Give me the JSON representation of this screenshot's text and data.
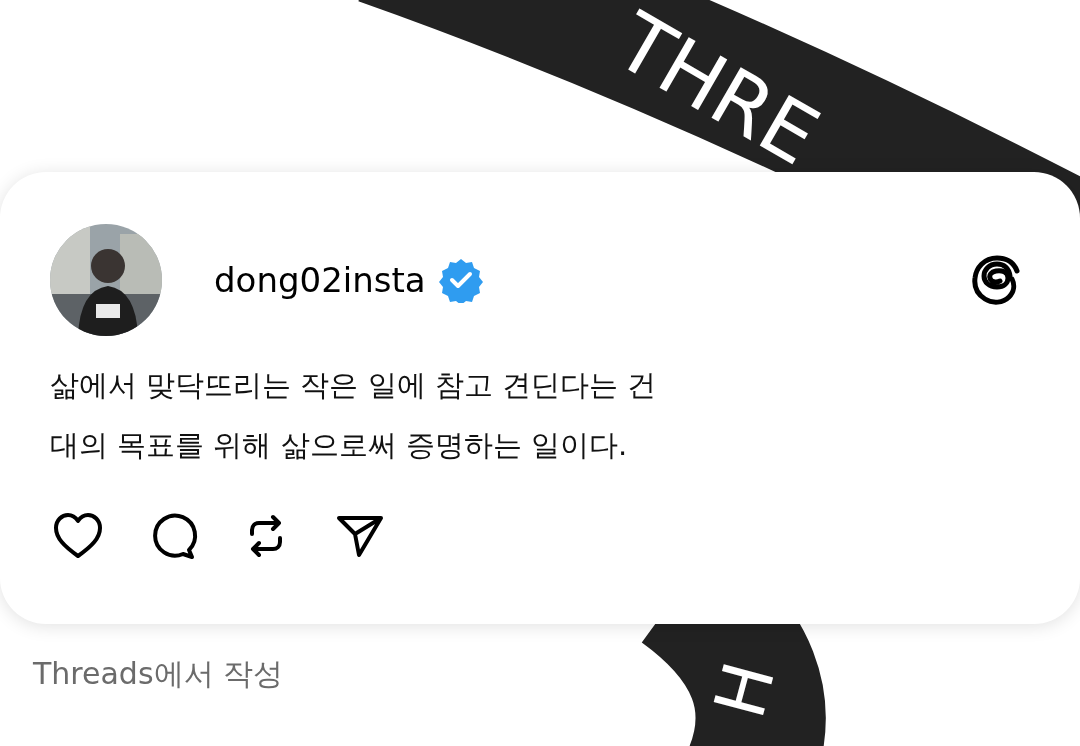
{
  "ribbon_texts": [
    "THRE",
    "H"
  ],
  "post": {
    "username": "dong02insta",
    "verified": true,
    "lines": [
      "삶에서 맞닥뜨리는 작은 일에 참고 견딘다는 건",
      "대의 목표를 위해 삶으로써 증명하는 일이다."
    ]
  },
  "footer": "Threads에서 작성"
}
